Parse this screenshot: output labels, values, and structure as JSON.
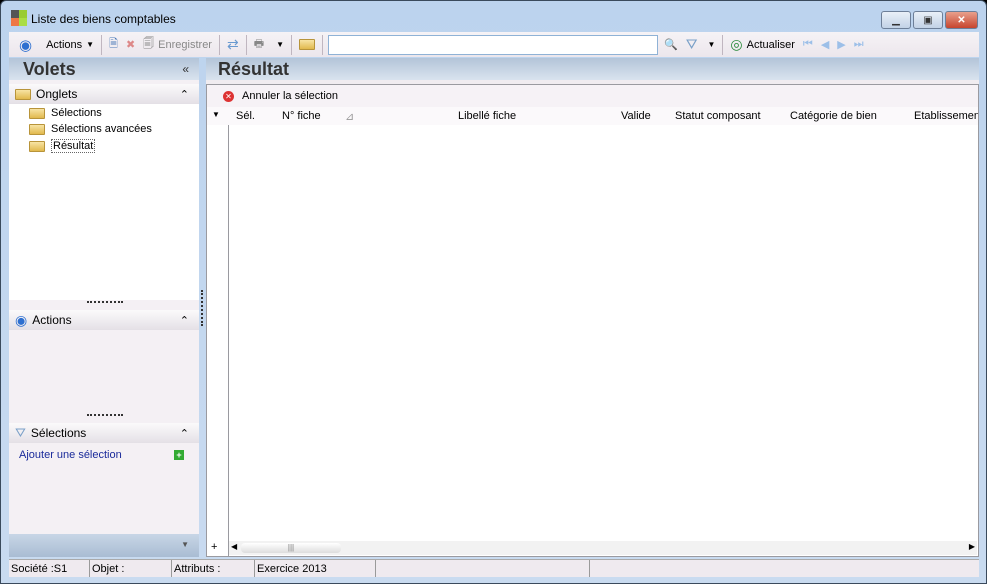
{
  "window": {
    "title": "Liste des biens comptables"
  },
  "toolbar": {
    "actions": "Actions",
    "save": "Enregistrer",
    "search_value": "",
    "refresh": "Actualiser"
  },
  "left": {
    "title": "Volets",
    "onglets": "Onglets",
    "tree": [
      "Sélections",
      "Sélections avancées",
      "Résultat"
    ],
    "actions": "Actions",
    "selections": "Sélections",
    "add_selection": "Ajouter une sélection"
  },
  "right": {
    "title": "Résultat",
    "cancel_selection": "Annuler la sélection",
    "columns": [
      "Sél.",
      "N° fiche",
      "Libellé fiche",
      "Valide",
      "Statut composant",
      "Catégorie de bien",
      "Etablissemen"
    ]
  },
  "status": {
    "societe": "Société :S1",
    "objet": "Objet :",
    "attributs": "Attributs :",
    "exercice": "Exercice 2013"
  }
}
